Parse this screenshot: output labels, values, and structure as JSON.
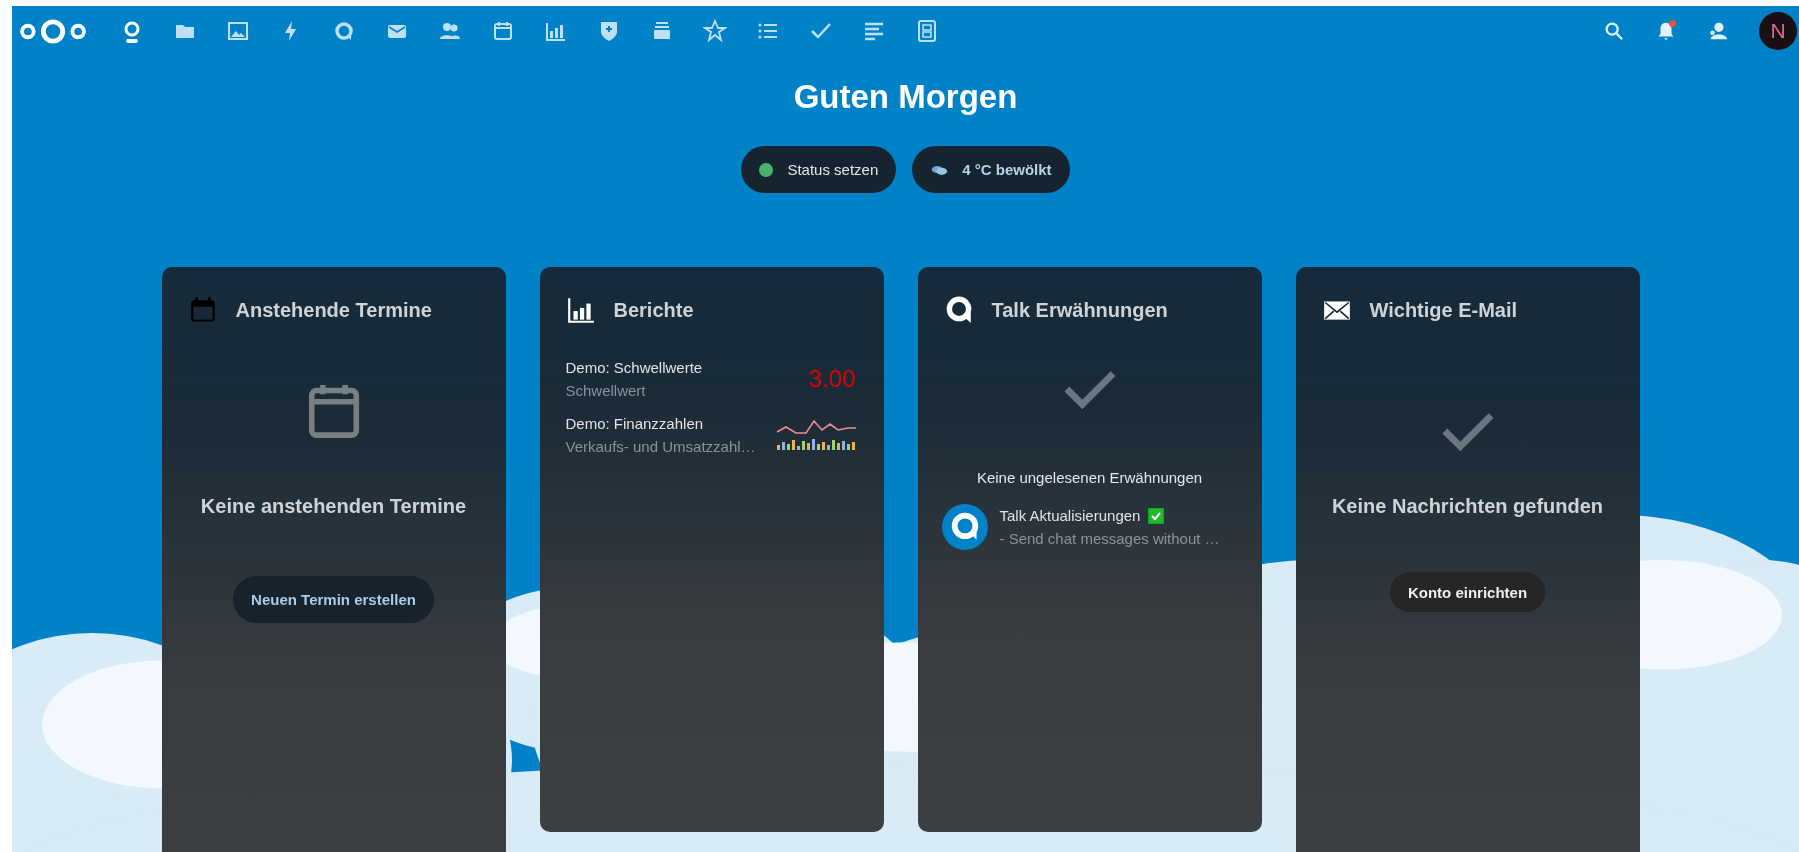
{
  "nav": {
    "apps": [
      {
        "kind": "dashboard",
        "selected": true
      },
      {
        "kind": "files",
        "selected": false
      },
      {
        "kind": "photos",
        "selected": false
      },
      {
        "kind": "activity",
        "selected": false
      },
      {
        "kind": "talk",
        "selected": false
      },
      {
        "kind": "mail",
        "selected": false
      },
      {
        "kind": "contacts",
        "selected": false
      },
      {
        "kind": "calendar",
        "selected": false
      },
      {
        "kind": "analytics",
        "selected": false
      },
      {
        "kind": "passwords",
        "selected": false
      },
      {
        "kind": "deck",
        "selected": false
      },
      {
        "kind": "cookbook",
        "selected": false
      },
      {
        "kind": "tasks",
        "selected": false
      },
      {
        "kind": "check",
        "selected": false
      },
      {
        "kind": "notes",
        "selected": false
      },
      {
        "kind": "forms",
        "selected": false
      }
    ],
    "notifications_unread": true,
    "avatar_initial": "N"
  },
  "greeting": "Guten Morgen",
  "status_buttons": [
    {
      "kind": "status",
      "label": "Status setzen"
    },
    {
      "kind": "weather",
      "label": "4 °C bewölkt"
    }
  ],
  "widgets": [
    {
      "kind": "calendar",
      "title": "Anstehende Termine",
      "empty_text": "Keine anstehenden Termine",
      "button": "Neuen Termin erstellen"
    },
    {
      "kind": "reports",
      "title": "Berichte",
      "items": [
        {
          "kind": "value",
          "title": "Demo: Schwellwerte",
          "subtitle": "Schwellwert",
          "value": "3.00"
        },
        {
          "kind": "sparkline",
          "title": "Demo: Finanzzahlen",
          "subtitle": "Verkaufs- und Umsatzzahl…"
        }
      ]
    },
    {
      "kind": "talk",
      "title": "Talk Erwähnungen",
      "empty_text": "Keine ungelesenen Erwähnungen",
      "items": [
        {
          "title": "Talk Aktualisierungen",
          "subtitle": "- Send chat messages without …",
          "checked": true
        }
      ]
    },
    {
      "kind": "mail",
      "title": "Wichtige E-Mail",
      "empty_text": "Keine Nachrichten gefunden",
      "button": "Konto einrichten"
    }
  ]
}
